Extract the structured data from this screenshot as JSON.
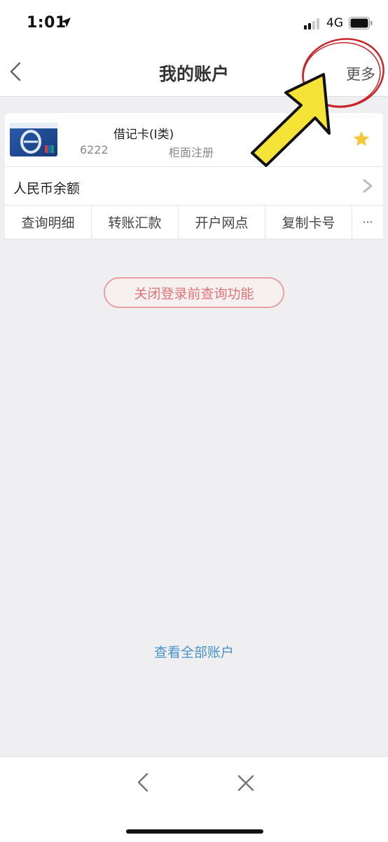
{
  "status_bar": {
    "time": "1:01",
    "network": "4G"
  },
  "header": {
    "title": "我的账户",
    "more_label": "更多"
  },
  "card": {
    "type": "借记卡(I类)",
    "number": "6222",
    "registration": "柜面注册",
    "favorite": true
  },
  "balance": {
    "label": "人民币余额"
  },
  "actions": [
    {
      "label": "查询明细"
    },
    {
      "label": "转账汇款"
    },
    {
      "label": "开户网点"
    },
    {
      "label": "复制卡号"
    },
    {
      "label": "···"
    }
  ],
  "close_query_button": {
    "label": "关闭登录前查询功能"
  },
  "view_all_link": {
    "label": "查看全部账户"
  },
  "colors": {
    "accent_link": "#4a93c9",
    "warning_text": "#e07575",
    "star": "#f5c53a",
    "background": "#efeff1"
  },
  "icons": {
    "back": "chevron-left-icon",
    "star": "star-icon",
    "balance_arrow": "chevron-right-icon",
    "bottom_back": "chevron-left-icon",
    "bottom_close": "close-icon"
  }
}
